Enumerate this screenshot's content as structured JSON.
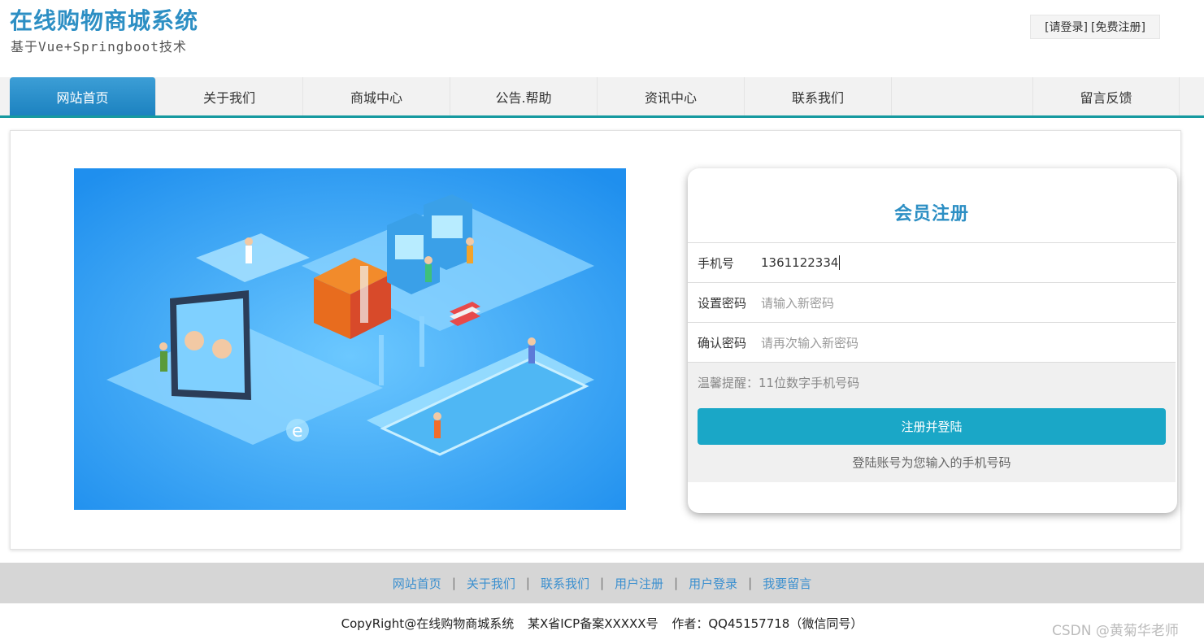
{
  "header": {
    "title": "在线购物商城系统",
    "subtitle": "基于Vue+Springboot技术",
    "login_link": "[请登录]",
    "register_link": "[免费注册]"
  },
  "nav": {
    "items": [
      {
        "label": "网站首页",
        "active": true
      },
      {
        "label": "关于我们",
        "active": false
      },
      {
        "label": "商城中心",
        "active": false
      },
      {
        "label": "公告.帮助",
        "active": false
      },
      {
        "label": "资讯中心",
        "active": false
      },
      {
        "label": "联系我们",
        "active": false
      },
      {
        "label": "留言反馈",
        "active": false
      }
    ]
  },
  "register": {
    "title": "会员注册",
    "phone_label": "手机号",
    "phone_value": "1361122334",
    "password_label": "设置密码",
    "password_placeholder": "请输入新密码",
    "confirm_label": "确认密码",
    "confirm_placeholder": "请再次输入新密码",
    "tip": "温馨提醒：11位数字手机号码",
    "submit_label": "注册并登陆",
    "note": "登陆账号为您输入的手机号码"
  },
  "illustration": {
    "icon": "isometric-online-services-illustration",
    "bg_color": "#2e9ef0"
  },
  "footer": {
    "links": [
      "网站首页",
      "关于我们",
      "联系我们",
      "用户注册",
      "用户登录",
      "我要留言"
    ],
    "copyright": "CopyRight@在线购物商城系统",
    "icp": "某X省ICP备案XXXXX号",
    "author": "作者：QQ45157718（微信同号）"
  },
  "watermark": "CSDN @黄菊华老师",
  "colors": {
    "brand": "#2d8fc4",
    "nav_border": "#169aa0",
    "button": "#1aa7c7"
  }
}
